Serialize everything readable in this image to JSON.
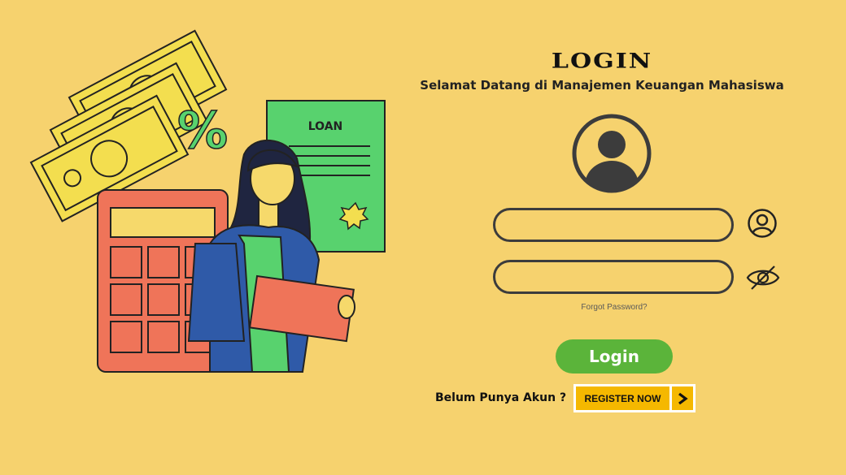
{
  "header": {
    "title": "LOGIN",
    "subtitle": "Selamat Datang di Manajemen Keuangan Mahasiswa"
  },
  "illustration": {
    "document_label": "LOAN",
    "percent_symbol": "%"
  },
  "form": {
    "username": {
      "value": "",
      "placeholder": ""
    },
    "password": {
      "value": "",
      "placeholder": ""
    },
    "forgot_password": "Forgot Password?",
    "login_label": "Login"
  },
  "register": {
    "prompt": "Belum Punya Akun ?",
    "button_label": "REGISTER NOW"
  },
  "icons": {
    "avatar": "user-avatar-icon",
    "username": "user-icon",
    "password": "eye-off-icon",
    "register_arrow": "chevron-right-icon"
  },
  "colors": {
    "background": "#f6d26e",
    "login_button": "#5bb43a",
    "register_button": "#f5b800",
    "field_border": "#3c3c3c"
  }
}
